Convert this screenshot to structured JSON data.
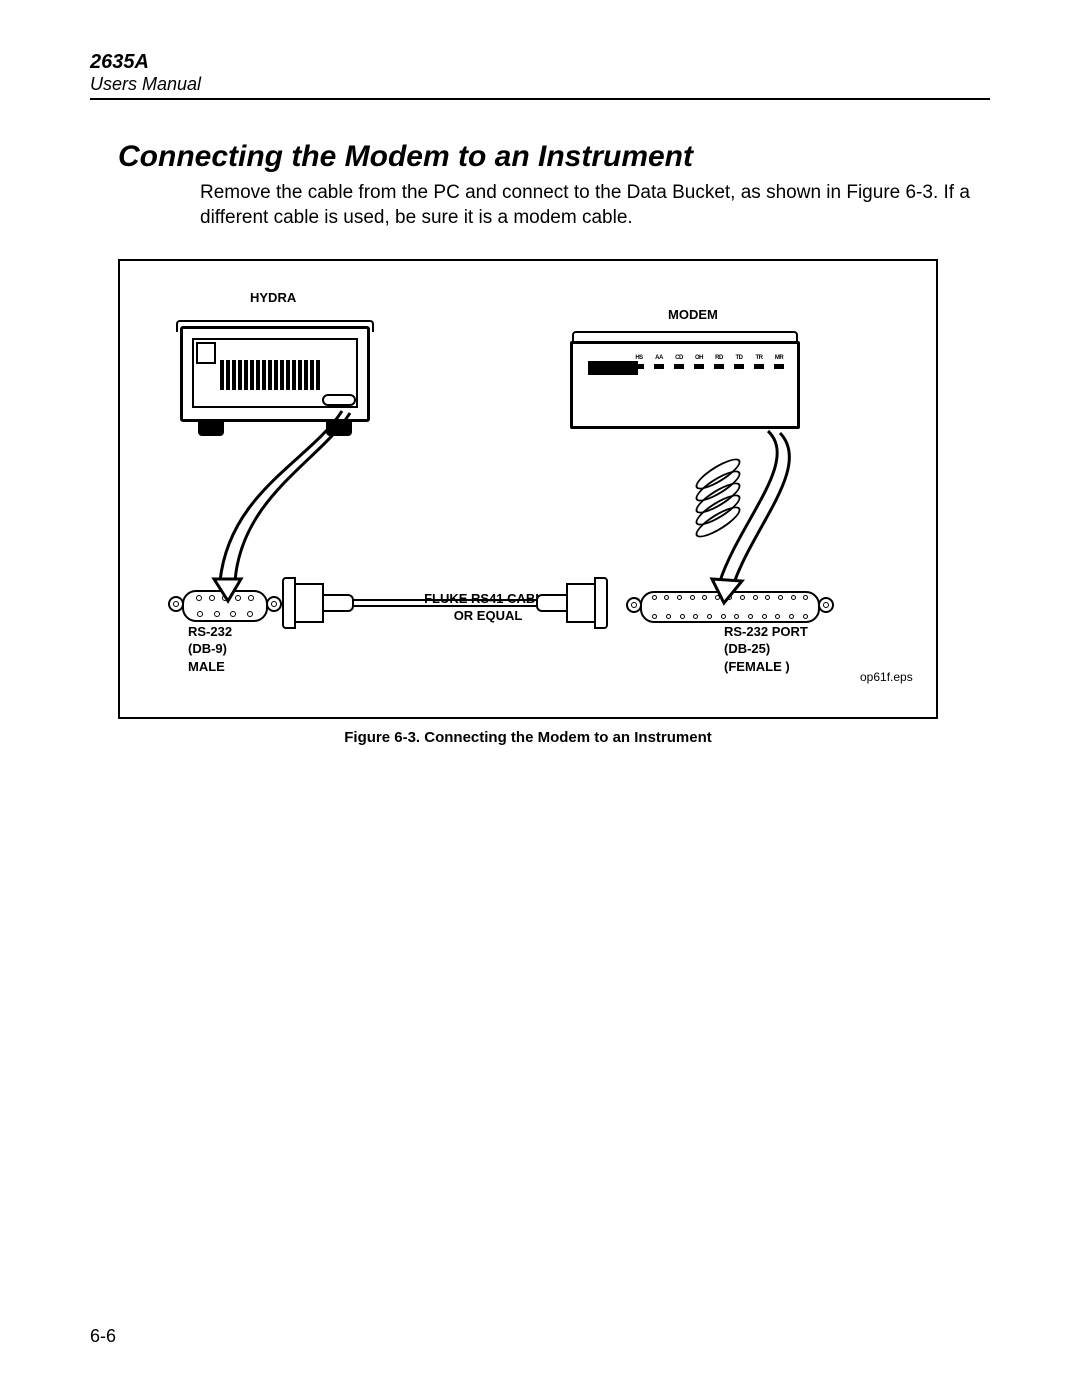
{
  "header": {
    "model": "2635A",
    "doctype": "Users Manual"
  },
  "section": {
    "title": "Connecting the Modem to an Instrument",
    "body": "Remove the cable from the PC and connect to the Data Bucket, as shown in Figure 6-3. If a different cable is used, be sure it is a modem cable."
  },
  "figure": {
    "labels": {
      "hydra": "HYDRA",
      "modem": "MODEM",
      "cable": "FLUKE RS41 CABLE\nOR EQUAL",
      "left_port": "RS-232\n(DB-9)\nMALE",
      "right_port": "RS-232 PORT\n(DB-25)\n(FEMALE )"
    },
    "modem_leds": [
      "HS",
      "AA",
      "CD",
      "OH",
      "RD",
      "TD",
      "TR",
      "MR"
    ],
    "eps_tag": "op61f.eps",
    "caption": "Figure 6-3. Connecting the Modem to an Instrument"
  },
  "page_number": "6-6"
}
